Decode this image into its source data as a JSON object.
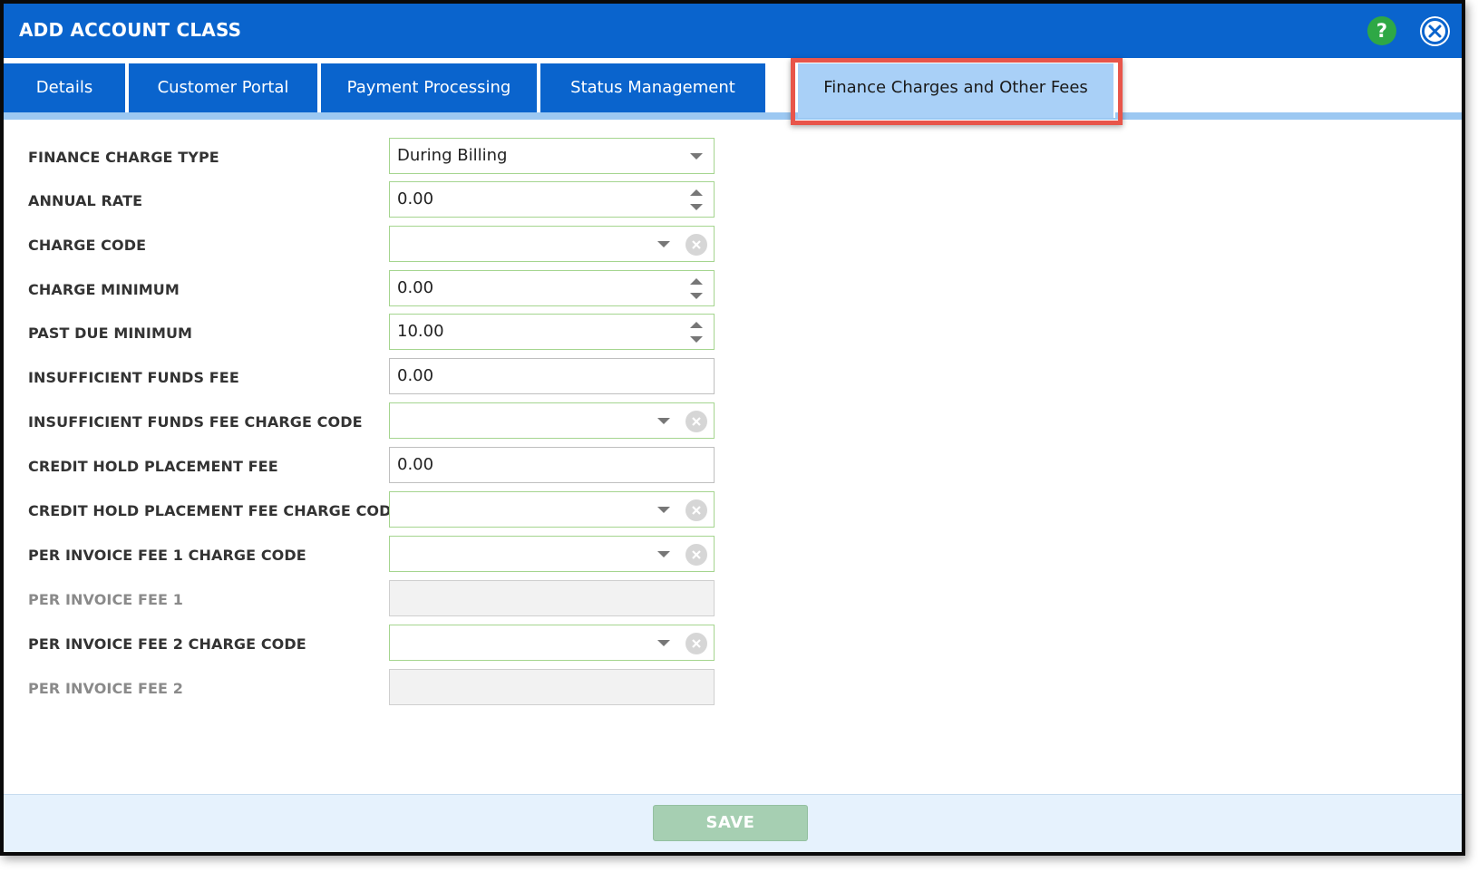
{
  "dialog": {
    "title": "ADD ACCOUNT CLASS",
    "help_symbol": "?"
  },
  "tabs": [
    {
      "label": "Details"
    },
    {
      "label": "Customer Portal"
    },
    {
      "label": "Payment Processing"
    },
    {
      "label": "Status Management"
    },
    {
      "label": "Finance Charges and Other Fees"
    }
  ],
  "active_tab": "Finance Charges and Other Fees",
  "form": {
    "finance_charge_type": {
      "label": "FINANCE CHARGE TYPE",
      "value": "During Billing"
    },
    "annual_rate": {
      "label": "ANNUAL RATE",
      "value": "0.00"
    },
    "charge_code": {
      "label": "CHARGE CODE",
      "value": ""
    },
    "charge_minimum": {
      "label": "CHARGE MINIMUM",
      "value": "0.00"
    },
    "past_due_minimum": {
      "label": "PAST DUE MINIMUM",
      "value": "10.00"
    },
    "insufficient_funds_fee": {
      "label": "INSUFFICIENT FUNDS FEE",
      "value": "0.00"
    },
    "insufficient_funds_fee_charge_code": {
      "label": "INSUFFICIENT FUNDS FEE CHARGE CODE",
      "value": ""
    },
    "credit_hold_placement_fee": {
      "label": "CREDIT HOLD PLACEMENT FEE",
      "value": "0.00"
    },
    "credit_hold_placement_fee_charge_code": {
      "label": "CREDIT HOLD PLACEMENT FEE CHARGE CODE",
      "value": ""
    },
    "per_invoice_fee_1_charge_code": {
      "label": "PER INVOICE FEE 1 CHARGE CODE",
      "value": ""
    },
    "per_invoice_fee_1": {
      "label": "PER INVOICE FEE 1",
      "value": ""
    },
    "per_invoice_fee_2_charge_code": {
      "label": "PER INVOICE FEE 2 CHARGE CODE",
      "value": ""
    },
    "per_invoice_fee_2": {
      "label": "PER INVOICE FEE 2",
      "value": ""
    }
  },
  "footer": {
    "save_label": "SAVE"
  },
  "colors": {
    "header_blue": "#0a64cd",
    "active_tab": "#a9d0f7",
    "highlight_border": "#e8554a",
    "help_green": "#2ea845",
    "save_disabled": "#a6cfb2"
  },
  "icons": [
    "help-icon",
    "close-icon",
    "chevron-down-icon",
    "spinner-icon",
    "clear-icon"
  ]
}
